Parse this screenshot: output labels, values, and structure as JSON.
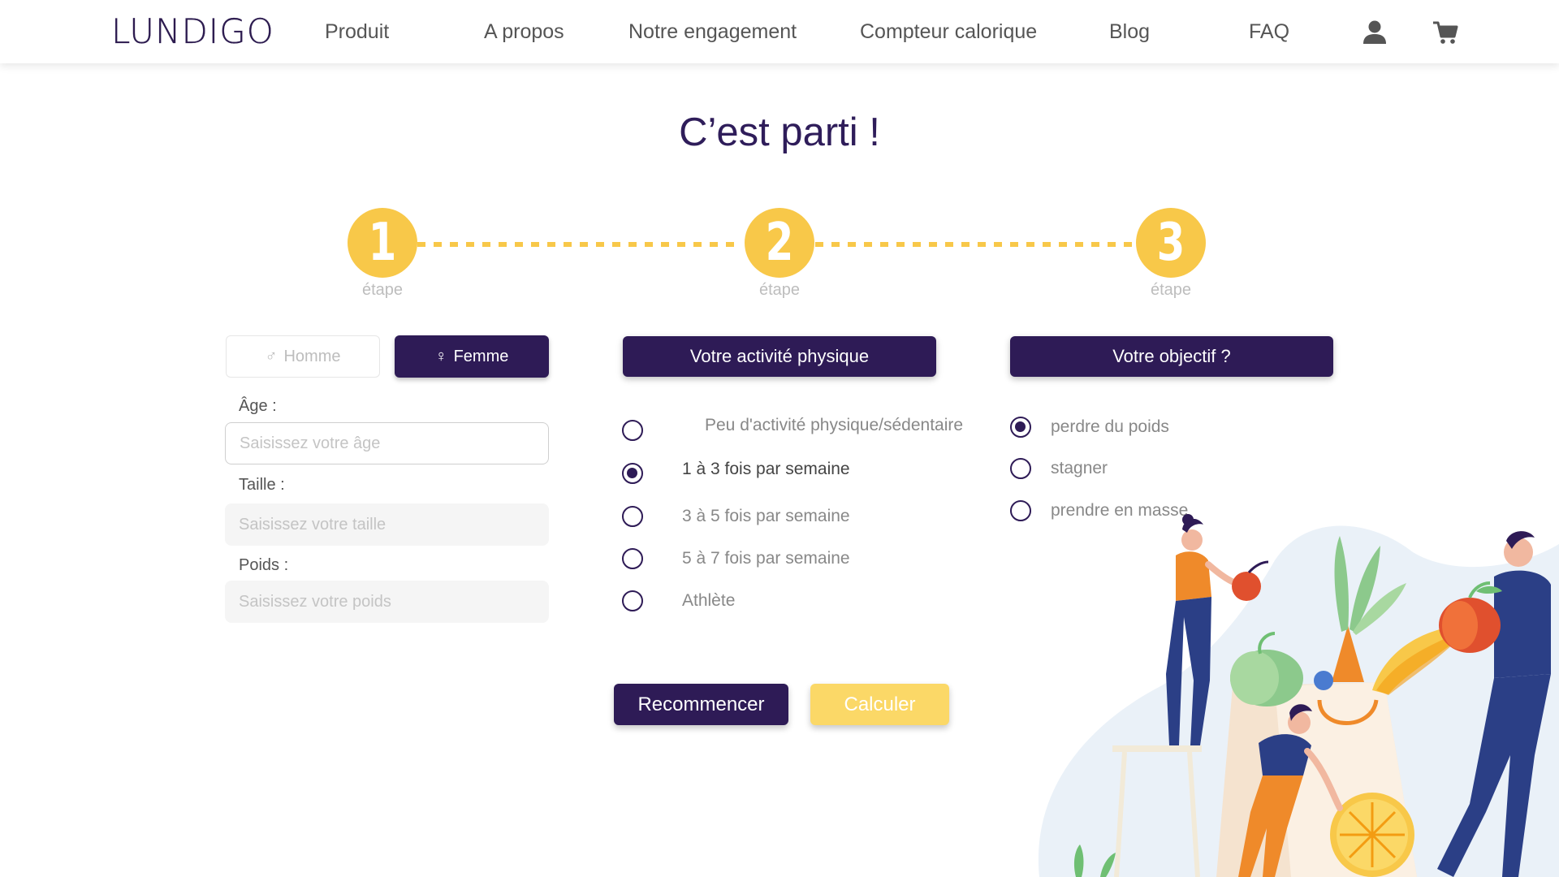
{
  "header": {
    "logo": "LUNDIGO",
    "nav": [
      "Produit",
      "A propos",
      "Notre engagement",
      "Compteur calorique",
      "Blog",
      "FAQ"
    ],
    "icons": [
      "user-icon",
      "cart-icon"
    ]
  },
  "title": "C’est parti !",
  "steps": [
    {
      "number": "1",
      "label": "étape"
    },
    {
      "number": "2",
      "label": "étape"
    },
    {
      "number": "3",
      "label": "étape"
    }
  ],
  "gender": {
    "homme": {
      "symbol": "♂",
      "label": "Homme"
    },
    "femme": {
      "symbol": "♀",
      "label": "Femme"
    },
    "selected": "Femme"
  },
  "fields": {
    "age": {
      "label": "Âge :",
      "placeholder": "Saisissez votre âge",
      "value": ""
    },
    "taille": {
      "label": "Taille :",
      "placeholder": "Saisissez votre taille",
      "value": ""
    },
    "poids": {
      "label": "Poids :",
      "placeholder": "Saisissez votre poids",
      "value": ""
    }
  },
  "activity": {
    "title": "Votre activité physique",
    "options": [
      "Peu d'activité physique/sédentaire",
      "1 à 3 fois par semaine",
      "3 à 5 fois par semaine",
      "5 à 7 fois par semaine",
      "Athlète"
    ],
    "selected": "1 à 3 fois par semaine"
  },
  "objective": {
    "title": "Votre objectif ?",
    "options": [
      "perdre du poids",
      "stagner",
      "prendre en masse"
    ],
    "selected": "perdre du poids"
  },
  "buttons": {
    "reset": "Recommencer",
    "calculate": "Calculer"
  },
  "colors": {
    "primary": "#2e1b56",
    "accent": "#f8c849",
    "button_yellow": "#fbd867"
  }
}
